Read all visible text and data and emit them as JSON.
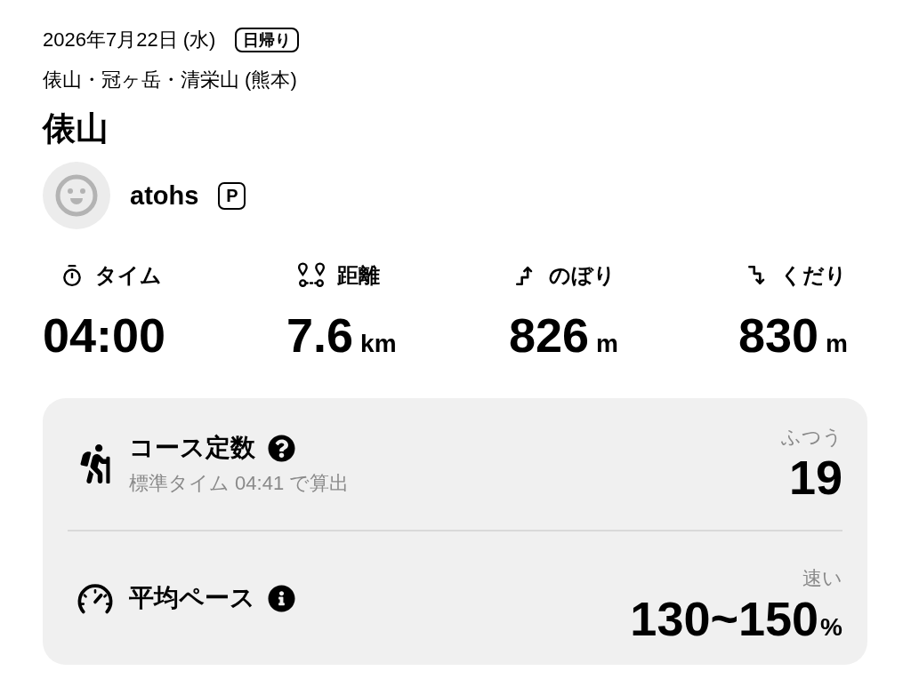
{
  "header": {
    "date": "2026年7月22日 (水)",
    "badge": "日帰り",
    "area": "俵山・冠ヶ岳・清栄山 (熊本)",
    "title": "俵山"
  },
  "user": {
    "name": "atohs",
    "badge": "P"
  },
  "stats": [
    {
      "kind": "time",
      "label": "タイム",
      "value": "04:00"
    },
    {
      "kind": "distance",
      "label": "距離",
      "value": "7.6",
      "unit": "km"
    },
    {
      "kind": "ascent",
      "label": "のぼり",
      "value": "826",
      "unit": "m"
    },
    {
      "kind": "descent",
      "label": "くだり",
      "value": "830",
      "unit": "m"
    }
  ],
  "summary": [
    {
      "kind": "course",
      "title": "コース定数",
      "note": "標準タイム 04:41 で算出",
      "rating": "ふつう",
      "value": "19"
    },
    {
      "kind": "pace",
      "title": "平均ペース",
      "rating": "速い",
      "value": "130~150",
      "unit": "%"
    }
  ]
}
